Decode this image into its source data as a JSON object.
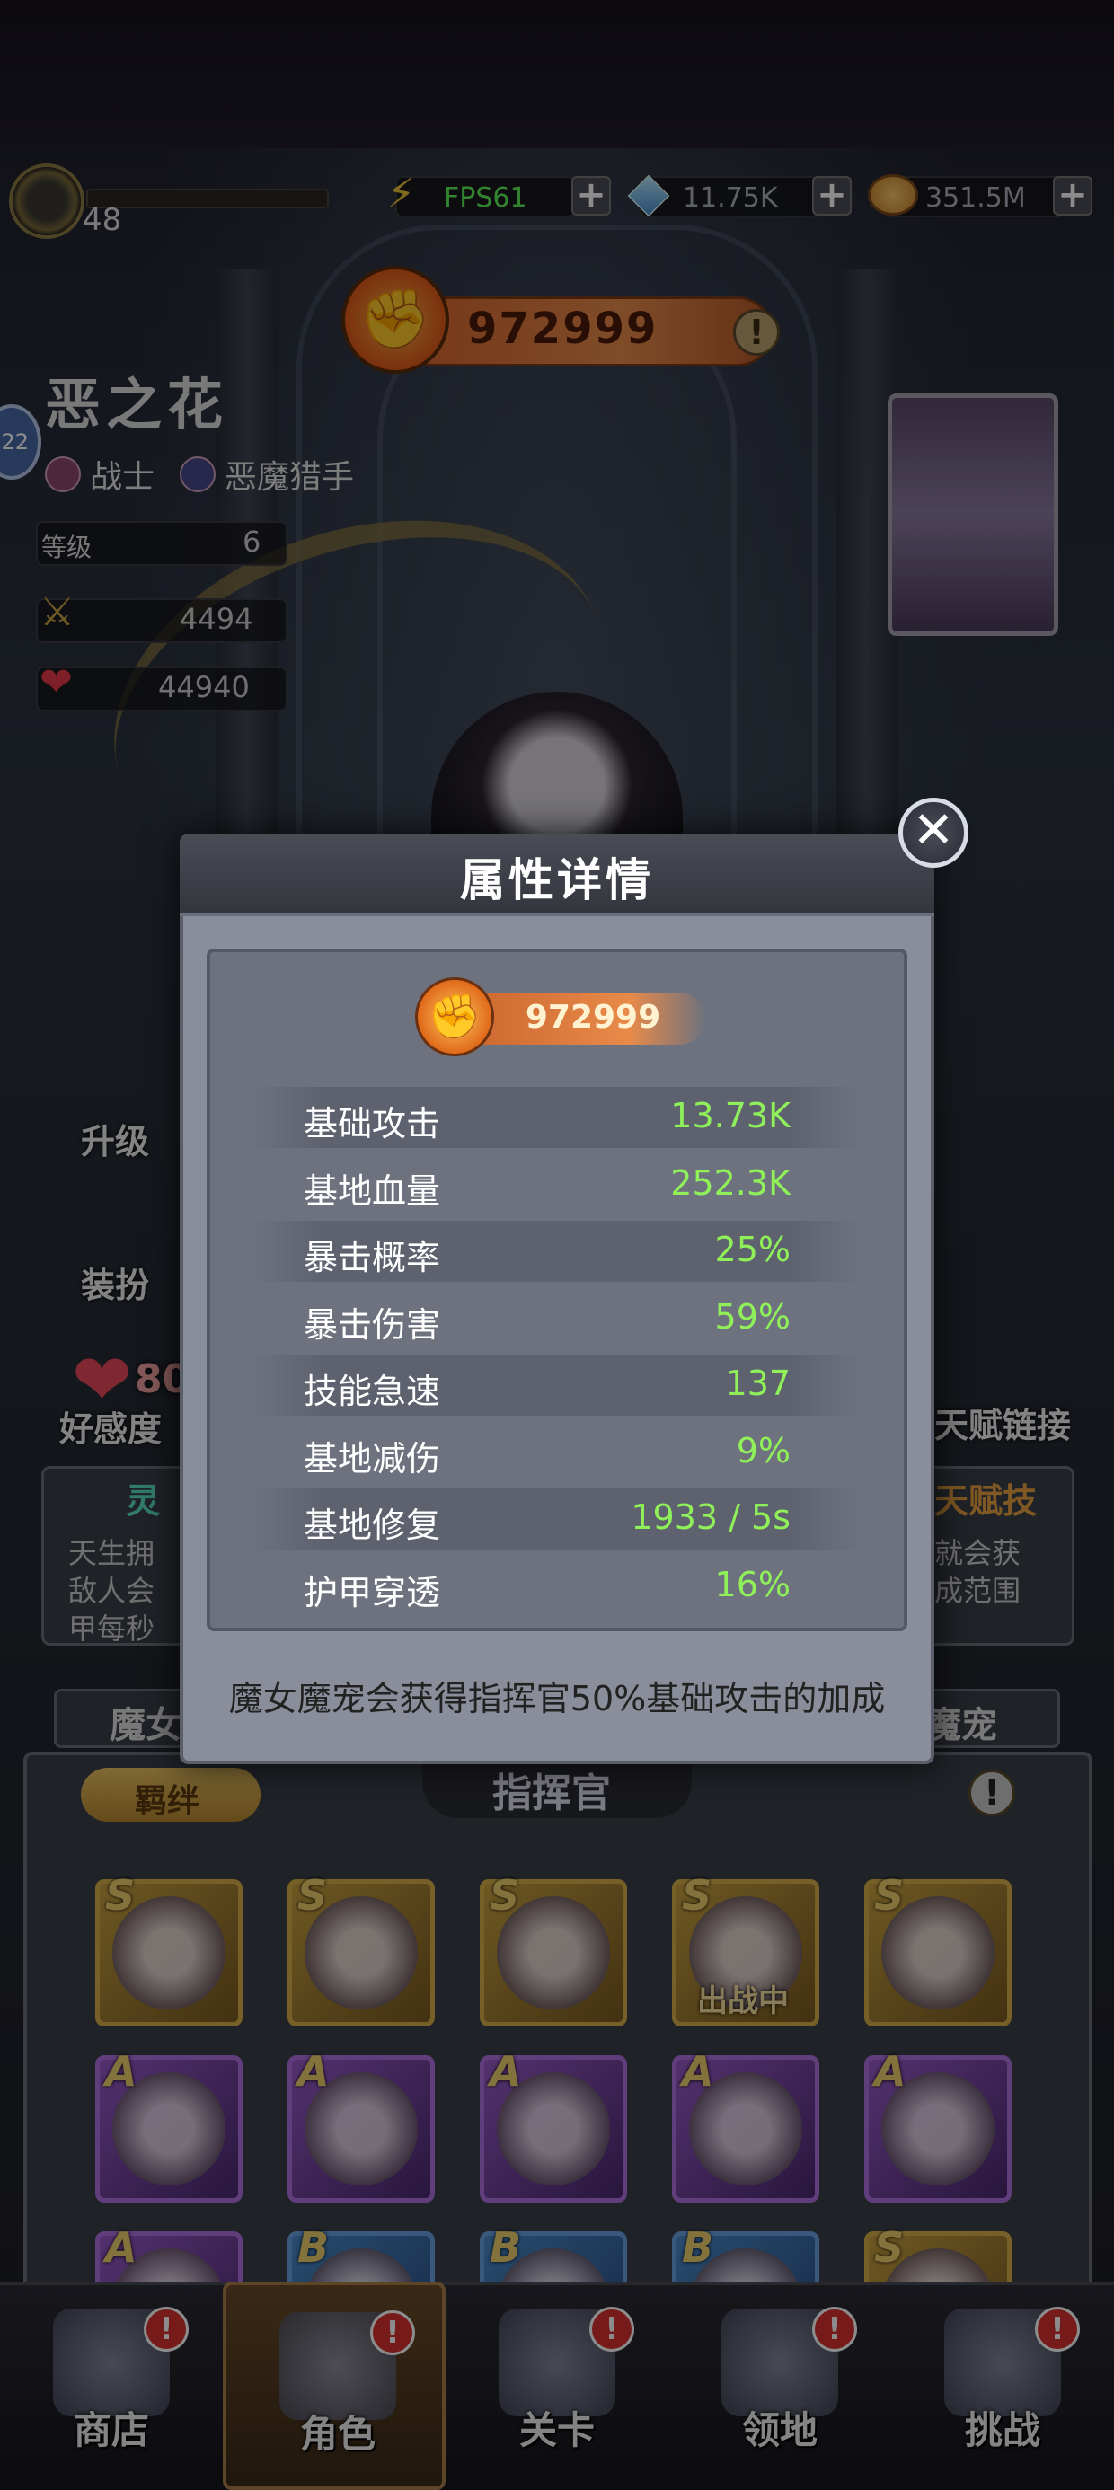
{
  "topbar": {
    "player_level": "48",
    "energy_label": "FPS61",
    "gems": "11.75K",
    "gold": "351.5M"
  },
  "hero": {
    "power": "972999",
    "name": "恶之花",
    "badge_level": "22",
    "class_label": "战士",
    "role_label": "恶魔猎手",
    "level_label": "等级",
    "level_value": "6",
    "attack_value": "4494",
    "hp_value": "44940"
  },
  "side_menu": {
    "upgrade": "升级",
    "dress": "装扮",
    "affection": "好感度",
    "affection_value": "80",
    "talent_link": "天赋链接",
    "talent_skill": "天赋技"
  },
  "background_text": {
    "spirit": "灵",
    "desc_left_1": "天生拥",
    "desc_left_2": "敌人会",
    "desc_left_3": "甲每秒",
    "desc_right_1": "就会获",
    "desc_right_2": "成范围",
    "tab_left": "魔女",
    "tab_right": "魔宠",
    "bond_button": "羁绊",
    "commander_title": "指挥官",
    "in_battle": "出战中"
  },
  "roster": {
    "rows": [
      [
        "S",
        "S",
        "S",
        "S",
        "S"
      ],
      [
        "A",
        "A",
        "A",
        "A",
        "A"
      ],
      [
        "A",
        "B",
        "B",
        "B",
        "S"
      ]
    ]
  },
  "modal": {
    "title": "属性详情",
    "close_glyph": "✕",
    "power": "972999",
    "attributes": [
      {
        "label": "基础攻击",
        "value": "13.73K"
      },
      {
        "label": "基地血量",
        "value": "252.3K"
      },
      {
        "label": "暴击概率",
        "value": "25%"
      },
      {
        "label": "暴击伤害",
        "value": "59%"
      },
      {
        "label": "技能急速",
        "value": "137"
      },
      {
        "label": "基地减伤",
        "value": "9%"
      },
      {
        "label": "基地修复",
        "value": "1933 / 5s"
      },
      {
        "label": "护甲穿透",
        "value": "16%"
      }
    ],
    "footnote": "魔女魔宠会获得指挥官50%基础攻击的加成"
  },
  "bottom_nav": [
    {
      "label": "商店",
      "icon": "shop-icon",
      "badge": "!"
    },
    {
      "label": "角色",
      "icon": "character-icon",
      "badge": "!",
      "active": true
    },
    {
      "label": "关卡",
      "icon": "crossed-swords-icon",
      "badge": "!"
    },
    {
      "label": "领地",
      "icon": "castle-icon",
      "badge": "!"
    },
    {
      "label": "挑战",
      "icon": "scroll-map-icon",
      "badge": "!"
    }
  ],
  "colors": {
    "attr_value_green": "#8ff05a",
    "power_orange": "#e88a4a",
    "alert_red": "#d83030"
  }
}
